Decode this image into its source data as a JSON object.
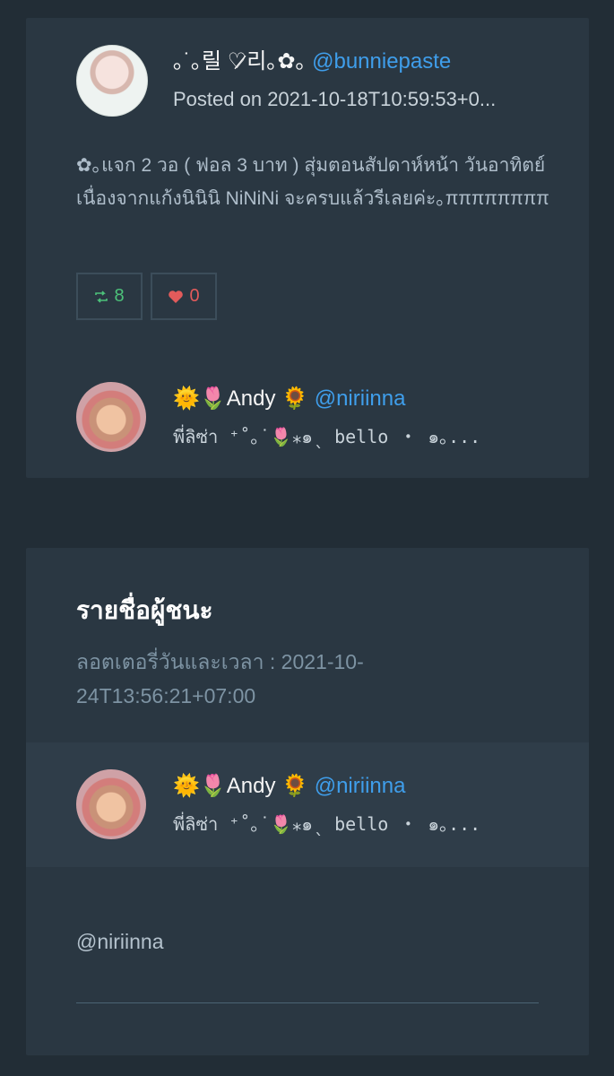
{
  "post": {
    "author": {
      "display_name": "｡˙｡릴 ♡̷리｡✿｡",
      "handle": "@bunniepaste",
      "avatar_icon": "profile-avatar"
    },
    "posted_on": "Posted on 2021-10-18T10:59:53+0...",
    "text": "✿｡แจก 2 วอ ( ฟอล 3 บาท ) สุ่มตอนสัปดาห์หน้า วันอาทิตย์เนื่องจากแก้งนินินิ NiNiNi จะครบแล้วรีเลยค่ะ｡ππππππππ",
    "retweets": "8",
    "likes": "0",
    "retweet_icon": "retweet-icon",
    "like_icon": "heart-icon",
    "colors": {
      "retweet": "#4cc27a",
      "like": "#e25b5b",
      "handle": "#3f9eeb"
    }
  },
  "participant": {
    "display_name": "🌞🌷Andy 🌻",
    "handle": "@niriinna",
    "bio": "พี่ลิซ่า ⁺˚｡˙🌷⁎๑ˎ bello  ・  ๑｡..."
  },
  "winners": {
    "title": "รายชื่อผู้ชนะ",
    "lottery_datetime": "ลอตเตอรี่วันและเวลา : 2021-10-24T13:56:21+07:00",
    "winner": {
      "display_name": "🌞🌷Andy 🌻",
      "handle": "@niriinna",
      "bio": "พี่ลิซ่า ⁺˚｡˙🌷⁎๑ˎ bello  ・  ๑｡..."
    },
    "reply_handle": "@niriinna"
  }
}
